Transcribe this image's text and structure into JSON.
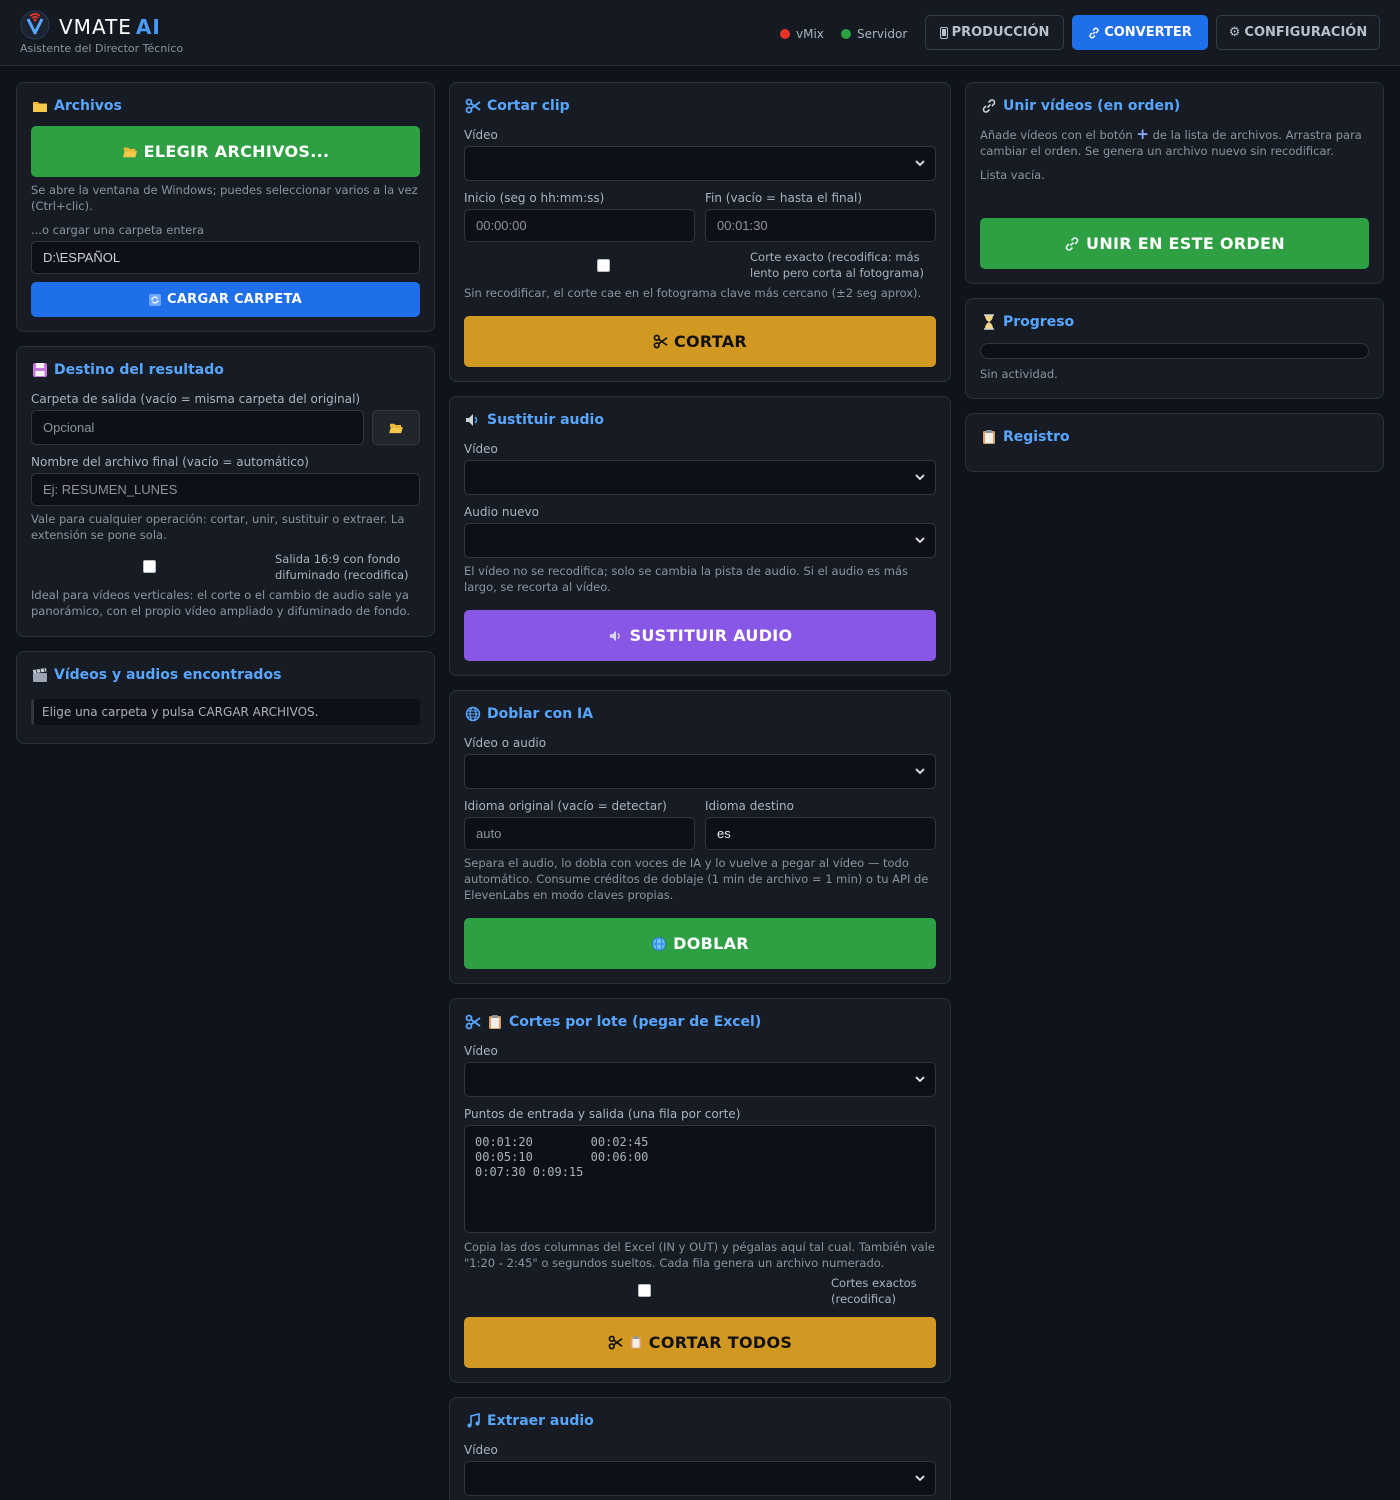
{
  "header": {
    "brand": "VMATE",
    "brand_ai": "AI",
    "subtitle": "Asistente del Director Técnico",
    "status_vmix": "vMix",
    "status_server": "Servidor",
    "nav_produccion": "PRODUCCIÓN",
    "nav_converter": "CONVERTER",
    "nav_configuracion": "CONFIGURACIÓN",
    "colors": {
      "vmix_dot": "#e5352b",
      "server_dot": "#2ea043",
      "accent": "#1f6feb"
    }
  },
  "archivos": {
    "title": "Archivos",
    "choose_btn": "ELEGIR ARCHIVOS...",
    "choose_hint": "Se abre la ventana de Windows; puedes seleccionar varios a la vez (Ctrl+clic).",
    "folder_label": "...o cargar una carpeta entera",
    "folder_value": "D:\\ESPAÑOL",
    "load_btn": "CARGAR CARPETA"
  },
  "destino": {
    "title": "Destino del resultado",
    "folder_label": "Carpeta de salida (vacío = misma carpeta del original)",
    "folder_placeholder": "Opcional",
    "name_label": "Nombre del archivo final (vacío = automático)",
    "name_placeholder": "Ej: RESUMEN_LUNES",
    "name_hint": "Vale para cualquier operación: cortar, unir, sustituir o extraer. La extensión se pone sola.",
    "checkbox_label": "Salida 16:9 con fondo difuminado (recodifica)",
    "checkbox_hint": "Ideal para vídeos verticales: el corte o el cambio de audio sale ya panorámico, con el propio vídeo ampliado y difuminado de fondo."
  },
  "encontrados": {
    "title": "Vídeos y audios encontrados",
    "empty": "Elige una carpeta y pulsa CARGAR ARCHIVOS."
  },
  "cortar": {
    "title": "Cortar clip",
    "video_label": "Vídeo",
    "start_label": "Inicio (seg o hh:mm:ss)",
    "start_value": "00:00:00",
    "end_label": "Fin (vacío = hasta el final)",
    "end_value": "00:01:30",
    "exact_label": "Corte exacto (recodifica: más lento pero corta al fotograma)",
    "hint": "Sin recodificar, el corte cae en el fotograma clave más cercano (±2 seg aprox).",
    "btn": "CORTAR"
  },
  "sustituir": {
    "title": "Sustituir audio",
    "video_label": "Vídeo",
    "audio_label": "Audio nuevo",
    "hint": "El vídeo no se recodifica; solo se cambia la pista de audio. Si el audio es más largo, se recorta al vídeo.",
    "btn": "SUSTITUIR AUDIO"
  },
  "doblar": {
    "title": "Doblar con IA",
    "media_label": "Vídeo o audio",
    "orig_label": "Idioma original (vacío = detectar)",
    "orig_placeholder": "auto",
    "dest_label": "Idioma destino",
    "dest_value": "es",
    "hint": "Separa el audio, lo dobla con voces de IA y lo vuelve a pegar al vídeo — todo automático. Consume créditos de doblaje (1 min de archivo = 1 min) o tu API de ElevenLabs en modo claves propias.",
    "btn": "DOBLAR"
  },
  "lote": {
    "title": "Cortes por lote (pegar de Excel)",
    "video_label": "Vídeo",
    "points_label": "Puntos de entrada y salida (una fila por corte)",
    "points_value": "00:01:20        00:02:45\n00:05:10        00:06:00\n0:07:30 0:09:15",
    "hint": "Copia las dos columnas del Excel (IN y OUT) y pégalas aquí tal cual. También vale \"1:20 - 2:45\" o segundos sueltos. Cada fila genera un archivo numerado.",
    "exact_label": "Cortes exactos (recodifica)",
    "btn": "CORTAR TODOS"
  },
  "extraer": {
    "title": "Extraer audio",
    "video_label": "Vídeo"
  },
  "unir": {
    "title": "Unir vídeos (en orden)",
    "hint_a": "Añade vídeos con el botón",
    "hint_b": "de la lista de archivos. Arrastra para cambiar el orden. Se genera un archivo nuevo sin recodificar.",
    "empty": "Lista vacía.",
    "btn": "UNIR EN ESTE ORDEN"
  },
  "progreso": {
    "title": "Progreso",
    "status": "Sin actividad.",
    "value": 0
  },
  "registro": {
    "title": "Registro"
  }
}
